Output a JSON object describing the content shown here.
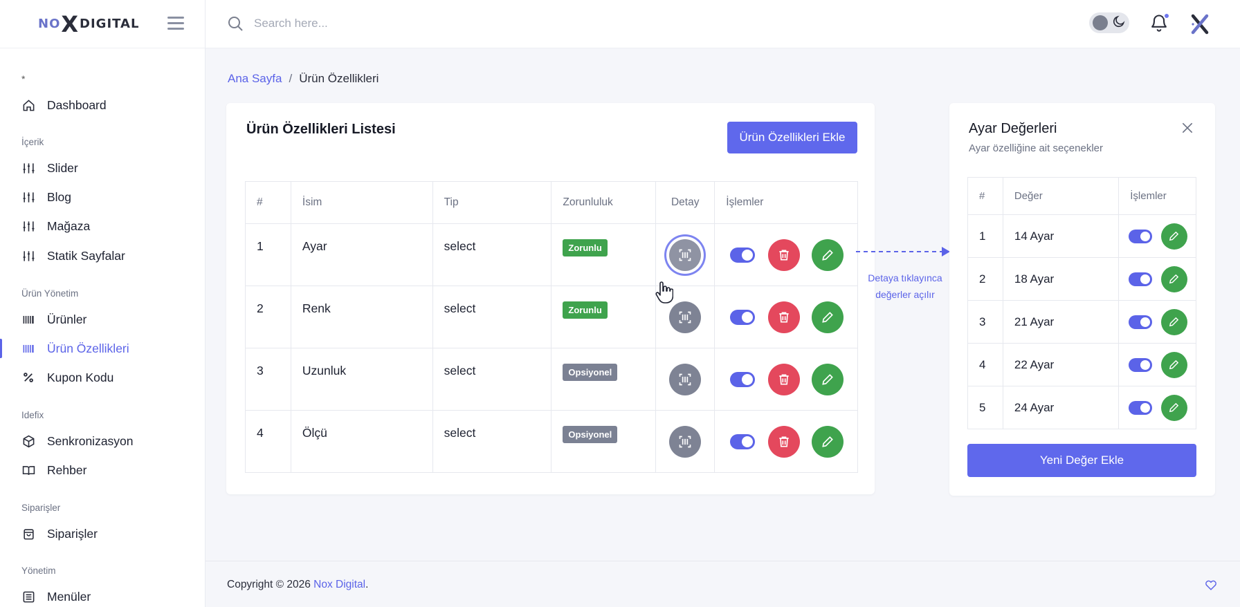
{
  "brand": {
    "logo_left": "NO",
    "logo_x": "X",
    "logo_right": "DIGITAL"
  },
  "search": {
    "placeholder": "Search here..."
  },
  "sidebar": {
    "star": "*",
    "sections": {
      "icerik": "İçerik",
      "urun_yonetim": "Ürün Yönetim",
      "idefix": "Idefix",
      "siparisler": "Siparişler",
      "yonetim": "Yönetim"
    },
    "items": {
      "dashboard": "Dashboard",
      "slider": "Slider",
      "blog": "Blog",
      "magaza": "Mağaza",
      "statik": "Statik Sayfalar",
      "urunler": "Ürünler",
      "urun_ozellikleri": "Ürün Özellikleri",
      "kupon": "Kupon Kodu",
      "senkronizasyon": "Senkronizasyon",
      "rehber": "Rehber",
      "siparisler": "Siparişler",
      "menuler": "Menüler"
    },
    "active": "urun_ozellikleri"
  },
  "breadcrumb": {
    "home": "Ana Sayfa",
    "sep": "/",
    "current": "Ürün Özellikleri"
  },
  "main": {
    "title": "Ürün Özellikleri Listesi",
    "add_button": "Ürün Özellikleri Ekle",
    "columns": {
      "num": "#",
      "name": "İsim",
      "type": "Tip",
      "required": "Zorunluluk",
      "detail": "Detay",
      "actions": "İşlemler"
    },
    "rows": [
      {
        "num": "1",
        "name": "Ayar",
        "type": "select",
        "badge": "Zorunlu",
        "badge_color": "#3fa34d",
        "active": true
      },
      {
        "num": "2",
        "name": "Renk",
        "type": "select",
        "badge": "Zorunlu",
        "badge_color": "#3fa34d",
        "active": true
      },
      {
        "num": "3",
        "name": "Uzunluk",
        "type": "select",
        "badge": "Opsiyonel",
        "badge_color": "#7b8193",
        "active": true
      },
      {
        "num": "4",
        "name": "Ölçü",
        "type": "select",
        "badge": "Opsiyonel",
        "badge_color": "#7b8193",
        "active": true
      }
    ]
  },
  "annotation": {
    "line1": "Detaya tıklayınca",
    "line2": "değerler açılır"
  },
  "panel": {
    "title": "Ayar Değerleri",
    "subtitle": "Ayar özelliğine ait seçenekler",
    "columns": {
      "num": "#",
      "value": "Değer",
      "actions": "İşlemler"
    },
    "rows": [
      {
        "num": "1",
        "value": "14 Ayar",
        "active": true
      },
      {
        "num": "2",
        "value": "18 Ayar",
        "active": true
      },
      {
        "num": "3",
        "value": "21 Ayar",
        "active": true
      },
      {
        "num": "4",
        "value": "22 Ayar",
        "active": true
      },
      {
        "num": "5",
        "value": "24 Ayar",
        "active": true
      }
    ],
    "new_button": "Yeni Değer Ekle"
  },
  "footer": {
    "copyright": "Copyright © 2026",
    "brand": "Nox Digital",
    "suffix": "."
  },
  "colors": {
    "accent": "#5b63e8",
    "success": "#3fa34d",
    "danger": "#e4485d",
    "neutral": "#7e8394"
  }
}
